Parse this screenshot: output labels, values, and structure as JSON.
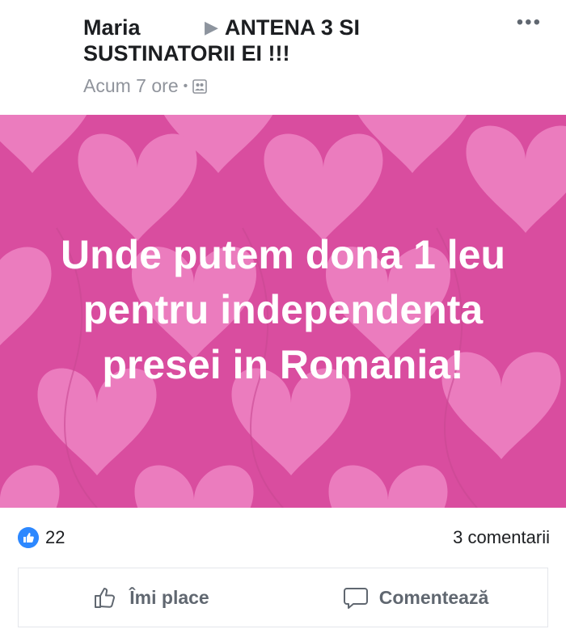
{
  "post": {
    "author": "Maria",
    "target_arrow": "▶",
    "target": "ANTENA 3 SI SUSTINATORII EI !!!",
    "timestamp": "Acum 7 ore",
    "separator": "•",
    "audience_icon": "group-icon",
    "more_label": "•••",
    "image_text": "Unde putem dona 1 leu pentru independenta presei in Romania!",
    "image_background_color": "#d94d9f",
    "heart_color": "#ef85c4"
  },
  "reactions": {
    "reaction_icon": "like-icon",
    "like_count": "22",
    "comments": "3 comentarii"
  },
  "actions": {
    "like_label": "Îmi place",
    "comment_label": "Comentează"
  }
}
